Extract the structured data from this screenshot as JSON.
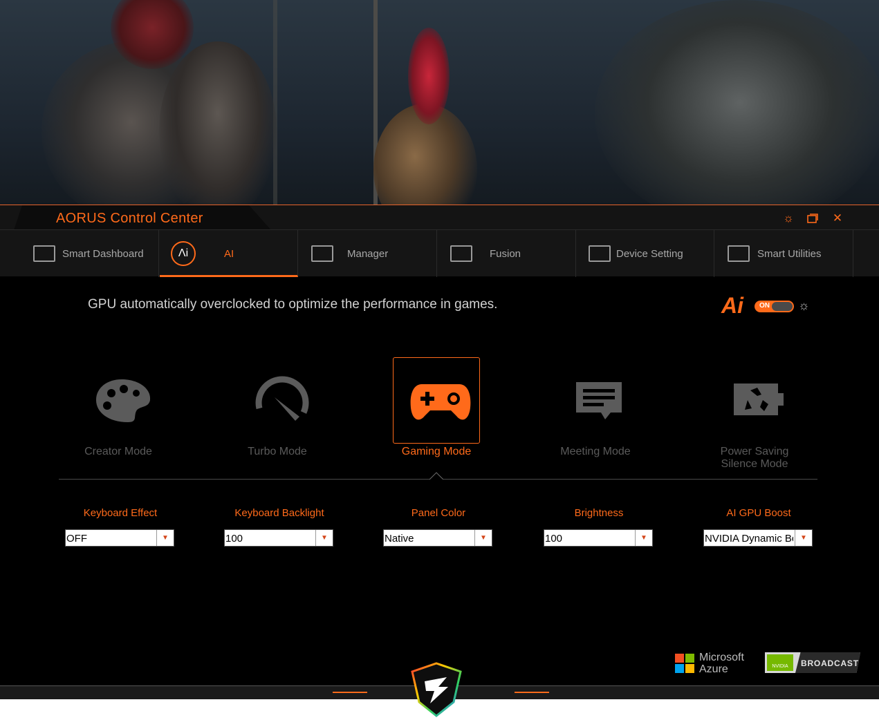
{
  "window": {
    "title": "AORUS Control Center",
    "controls": [
      "settings-icon",
      "restore-icon",
      "close-icon"
    ],
    "accent_color": "#ff6a1a"
  },
  "nav": {
    "tabs": [
      {
        "label": "Smart Dashboard",
        "icon": "dashboard-icon",
        "active": false
      },
      {
        "label": "AI",
        "icon": "ai-icon",
        "active": true
      },
      {
        "label": "Manager",
        "icon": "keyboard-icon",
        "active": false
      },
      {
        "label": "Fusion",
        "icon": "rgb-keyboard-icon",
        "active": false
      },
      {
        "label": "Device Setting",
        "icon": "device-icon",
        "active": false
      },
      {
        "label": "Smart Utilities",
        "icon": "utilities-icon",
        "active": false
      }
    ]
  },
  "ai": {
    "description": "GPU automatically overclocked to optimize the performance in games.",
    "logo_text": "Ai",
    "toggle_label": "ON",
    "toggle_on": true
  },
  "modes": [
    {
      "label": "Creator Mode",
      "icon": "palette-icon",
      "active": false
    },
    {
      "label": "Turbo Mode",
      "icon": "speedometer-icon",
      "active": false
    },
    {
      "label": "Gaming Mode",
      "icon": "gamepad-icon",
      "active": true
    },
    {
      "label": "Meeting Mode",
      "icon": "chat-icon",
      "active": false
    },
    {
      "label_line1": "Power Saving",
      "label_line2": "Silence Mode",
      "icon": "eco-battery-icon",
      "active": false
    }
  ],
  "settings": [
    {
      "label": "Keyboard Effect",
      "value": "OFF"
    },
    {
      "label": "Keyboard Backlight",
      "value": "100"
    },
    {
      "label": "Panel Color",
      "value": "Native"
    },
    {
      "label": "Brightness",
      "value": "100"
    },
    {
      "label": "AI GPU Boost",
      "value": "NVIDIA Dynamic Boost"
    }
  ],
  "footer": {
    "microsoft_line1": "Microsoft",
    "microsoft_line2": "Azure",
    "nvidia_small": "NVIDIA",
    "nvidia_label": "BROADCAST"
  }
}
